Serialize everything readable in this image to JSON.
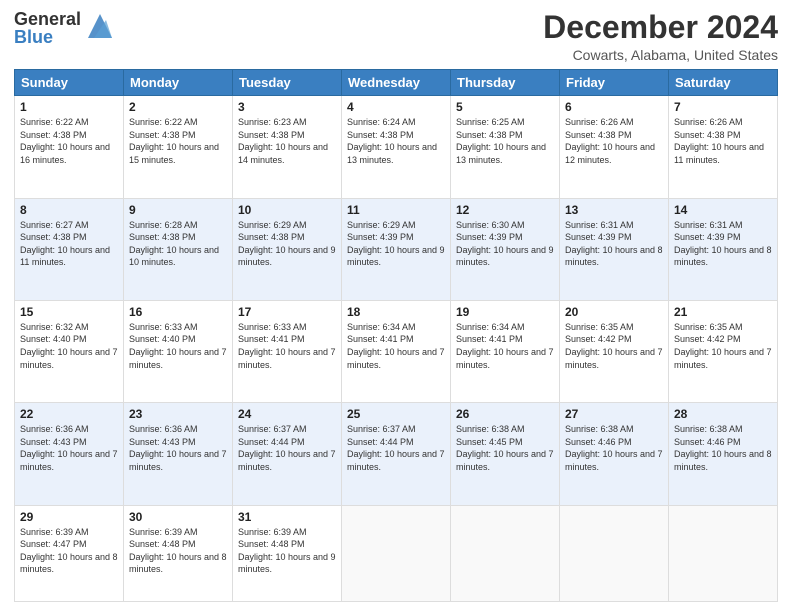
{
  "header": {
    "logo_general": "General",
    "logo_blue": "Blue",
    "main_title": "December 2024",
    "subtitle": "Cowarts, Alabama, United States"
  },
  "days_of_week": [
    "Sunday",
    "Monday",
    "Tuesday",
    "Wednesday",
    "Thursday",
    "Friday",
    "Saturday"
  ],
  "weeks": [
    [
      {
        "day": "1",
        "sunrise": "6:22 AM",
        "sunset": "4:38 PM",
        "daylight": "10 hours and 16 minutes."
      },
      {
        "day": "2",
        "sunrise": "6:22 AM",
        "sunset": "4:38 PM",
        "daylight": "10 hours and 15 minutes."
      },
      {
        "day": "3",
        "sunrise": "6:23 AM",
        "sunset": "4:38 PM",
        "daylight": "10 hours and 14 minutes."
      },
      {
        "day": "4",
        "sunrise": "6:24 AM",
        "sunset": "4:38 PM",
        "daylight": "10 hours and 13 minutes."
      },
      {
        "day": "5",
        "sunrise": "6:25 AM",
        "sunset": "4:38 PM",
        "daylight": "10 hours and 13 minutes."
      },
      {
        "day": "6",
        "sunrise": "6:26 AM",
        "sunset": "4:38 PM",
        "daylight": "10 hours and 12 minutes."
      },
      {
        "day": "7",
        "sunrise": "6:26 AM",
        "sunset": "4:38 PM",
        "daylight": "10 hours and 11 minutes."
      }
    ],
    [
      {
        "day": "8",
        "sunrise": "6:27 AM",
        "sunset": "4:38 PM",
        "daylight": "10 hours and 11 minutes."
      },
      {
        "day": "9",
        "sunrise": "6:28 AM",
        "sunset": "4:38 PM",
        "daylight": "10 hours and 10 minutes."
      },
      {
        "day": "10",
        "sunrise": "6:29 AM",
        "sunset": "4:38 PM",
        "daylight": "10 hours and 9 minutes."
      },
      {
        "day": "11",
        "sunrise": "6:29 AM",
        "sunset": "4:39 PM",
        "daylight": "10 hours and 9 minutes."
      },
      {
        "day": "12",
        "sunrise": "6:30 AM",
        "sunset": "4:39 PM",
        "daylight": "10 hours and 9 minutes."
      },
      {
        "day": "13",
        "sunrise": "6:31 AM",
        "sunset": "4:39 PM",
        "daylight": "10 hours and 8 minutes."
      },
      {
        "day": "14",
        "sunrise": "6:31 AM",
        "sunset": "4:39 PM",
        "daylight": "10 hours and 8 minutes."
      }
    ],
    [
      {
        "day": "15",
        "sunrise": "6:32 AM",
        "sunset": "4:40 PM",
        "daylight": "10 hours and 7 minutes."
      },
      {
        "day": "16",
        "sunrise": "6:33 AM",
        "sunset": "4:40 PM",
        "daylight": "10 hours and 7 minutes."
      },
      {
        "day": "17",
        "sunrise": "6:33 AM",
        "sunset": "4:41 PM",
        "daylight": "10 hours and 7 minutes."
      },
      {
        "day": "18",
        "sunrise": "6:34 AM",
        "sunset": "4:41 PM",
        "daylight": "10 hours and 7 minutes."
      },
      {
        "day": "19",
        "sunrise": "6:34 AM",
        "sunset": "4:41 PM",
        "daylight": "10 hours and 7 minutes."
      },
      {
        "day": "20",
        "sunrise": "6:35 AM",
        "sunset": "4:42 PM",
        "daylight": "10 hours and 7 minutes."
      },
      {
        "day": "21",
        "sunrise": "6:35 AM",
        "sunset": "4:42 PM",
        "daylight": "10 hours and 7 minutes."
      }
    ],
    [
      {
        "day": "22",
        "sunrise": "6:36 AM",
        "sunset": "4:43 PM",
        "daylight": "10 hours and 7 minutes."
      },
      {
        "day": "23",
        "sunrise": "6:36 AM",
        "sunset": "4:43 PM",
        "daylight": "10 hours and 7 minutes."
      },
      {
        "day": "24",
        "sunrise": "6:37 AM",
        "sunset": "4:44 PM",
        "daylight": "10 hours and 7 minutes."
      },
      {
        "day": "25",
        "sunrise": "6:37 AM",
        "sunset": "4:44 PM",
        "daylight": "10 hours and 7 minutes."
      },
      {
        "day": "26",
        "sunrise": "6:38 AM",
        "sunset": "4:45 PM",
        "daylight": "10 hours and 7 minutes."
      },
      {
        "day": "27",
        "sunrise": "6:38 AM",
        "sunset": "4:46 PM",
        "daylight": "10 hours and 7 minutes."
      },
      {
        "day": "28",
        "sunrise": "6:38 AM",
        "sunset": "4:46 PM",
        "daylight": "10 hours and 8 minutes."
      }
    ],
    [
      {
        "day": "29",
        "sunrise": "6:39 AM",
        "sunset": "4:47 PM",
        "daylight": "10 hours and 8 minutes."
      },
      {
        "day": "30",
        "sunrise": "6:39 AM",
        "sunset": "4:48 PM",
        "daylight": "10 hours and 8 minutes."
      },
      {
        "day": "31",
        "sunrise": "6:39 AM",
        "sunset": "4:48 PM",
        "daylight": "10 hours and 9 minutes."
      },
      null,
      null,
      null,
      null
    ]
  ]
}
